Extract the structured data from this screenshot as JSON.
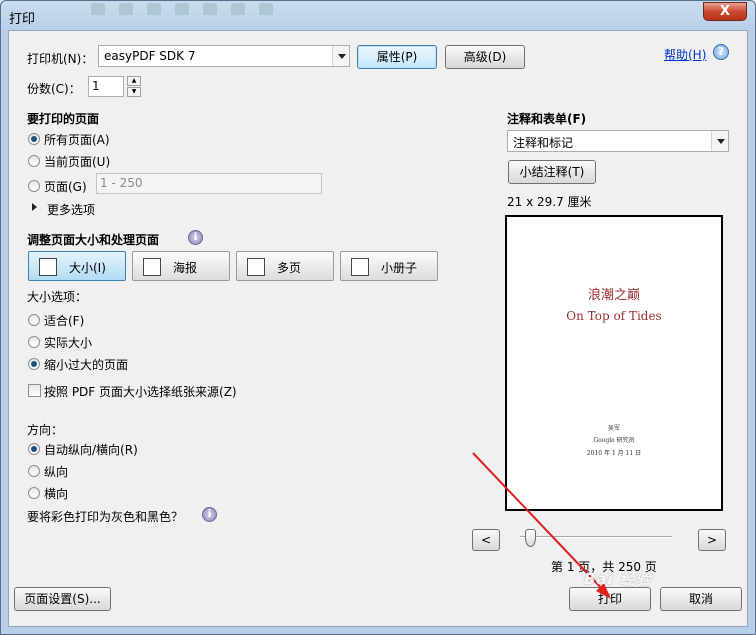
{
  "window": {
    "title": "打印",
    "close_label": "X"
  },
  "printer": {
    "label": "打印机(N)：",
    "selected": "easyPDF SDK 7",
    "properties_label": "属性(P)",
    "advanced_label": "高级(D)",
    "help_label": "帮助(H)"
  },
  "copies": {
    "label": "份数(C)：",
    "value": "1"
  },
  "pages_to_print": {
    "heading": "要打印的页面",
    "all": "所有页面(A)",
    "current": "当前页面(U)",
    "pages": "页面(G)",
    "pages_placeholder": "1 - 250",
    "more_options": "更多选项"
  },
  "page_handling": {
    "heading": "调整页面大小和处理页面",
    "tabs": [
      "大小(I)",
      "海报",
      "多页",
      "小册子"
    ],
    "size_options_label": "大小选项：",
    "fit": "适合(F)",
    "actual_size": "实际大小",
    "shrink": "缩小过大的页面",
    "choose_paper": "按照 PDF 页面大小选择纸张来源(Z)"
  },
  "orientation": {
    "label": "方向：",
    "auto": "自动纵向/横向(R)",
    "portrait": "纵向",
    "landscape": "横向"
  },
  "grayscale": {
    "label": "要将彩色打印为灰色和黑色？"
  },
  "comments": {
    "heading": "注释和表单(F)",
    "selected": "注释和标记",
    "summarize_label": "小结注释(T)",
    "paper_size": "21 x 29.7 厘米"
  },
  "preview": {
    "title_cn": "浪潮之巅",
    "title_en": "On Top of Tides",
    "author": "吴军",
    "org": "Google 研究员",
    "date": "2010 年 1 月 11 日",
    "prev_label": "<",
    "next_label": ">",
    "page_indicator": "第 1 页，共 250 页"
  },
  "footer": {
    "page_setup_label": "页面设置(S)...",
    "print_label": "打印",
    "cancel_label": "取消"
  },
  "watermark": "Bai 经验",
  "colors": {
    "arrow": "#e02020",
    "preview_title": "#9b2f2f",
    "link": "#0033cc"
  }
}
